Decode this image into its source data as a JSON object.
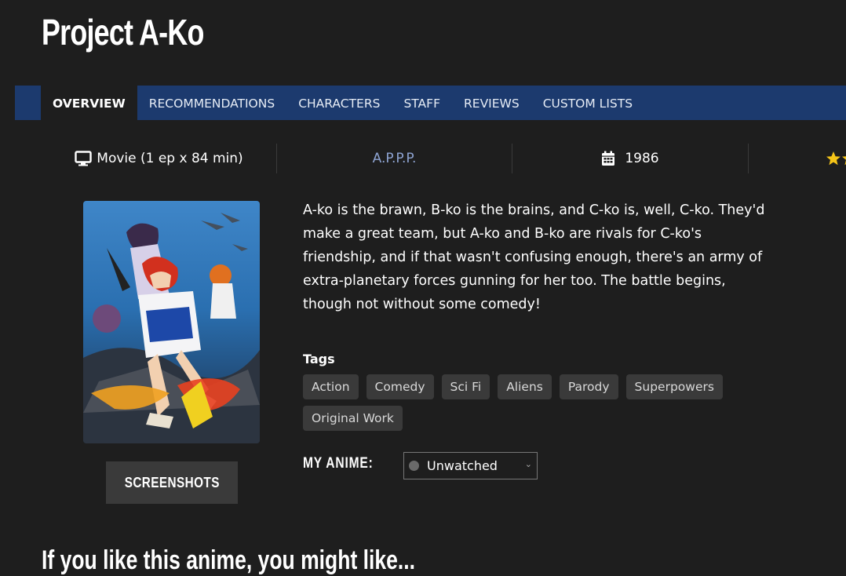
{
  "page": {
    "title": "Project A-Ko"
  },
  "tabs": [
    {
      "label": "OVERVIEW",
      "active": true
    },
    {
      "label": "RECOMMENDATIONS"
    },
    {
      "label": "CHARACTERS"
    },
    {
      "label": "STAFF"
    },
    {
      "label": "REVIEWS"
    },
    {
      "label": "CUSTOM LISTS"
    }
  ],
  "info": {
    "type_icon": "monitor-icon",
    "type": "Movie (1 ep x 84 min)",
    "studio": "A.P.P.P.",
    "year_icon": "calendar-icon",
    "year": "1986",
    "rating_icon": "star-icon"
  },
  "poster": {
    "alt": "プロジェクトA子"
  },
  "screenshots_label": "SCREENSHOTS",
  "synopsis": "A-ko is the brawn, B-ko is the brains, and C-ko is, well, C-ko. They'd make a great team, but A-ko and B-ko are rivals for C-ko's friendship, and if that wasn't confusing enough, there's an army of extra-planetary forces gunning for her too. The battle begins, though not without some comedy!",
  "tags": {
    "label": "Tags",
    "items": [
      "Action",
      "Comedy",
      "Sci Fi",
      "Aliens",
      "Parody",
      "Superpowers",
      "Original Work"
    ]
  },
  "my_anime": {
    "label": "MY ANIME:",
    "status": "Unwatched",
    "status_color": "#6a6a6a"
  },
  "colors": {
    "background": "#1e1e1e",
    "tabbar": "#1c3a6e",
    "studio_link": "#8ea4d2",
    "star": "#f5c518"
  },
  "bottom_heading": "If you like this anime, you might like..."
}
